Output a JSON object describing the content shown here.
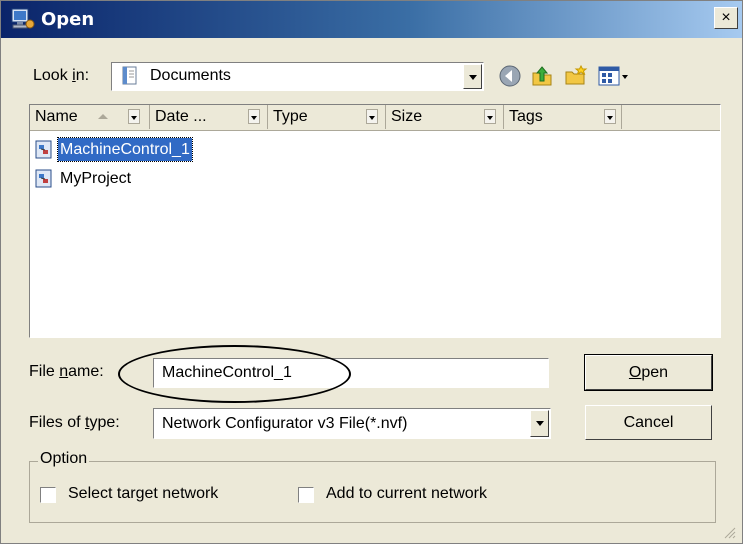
{
  "window": {
    "title": "Open",
    "close_glyph": "×"
  },
  "look_in": {
    "label_pre": "Look ",
    "label_key": "i",
    "label_post": "n:",
    "value": "Documents"
  },
  "columns": [
    {
      "label": "Name"
    },
    {
      "label": "Date ..."
    },
    {
      "label": "Type"
    },
    {
      "label": "Size"
    },
    {
      "label": "Tags"
    }
  ],
  "files": [
    {
      "name": "MachineControl_1",
      "selected": true
    },
    {
      "name": "MyProject",
      "selected": false
    }
  ],
  "file_name": {
    "label_pre": "File ",
    "label_key": "n",
    "label_post": "ame:",
    "value": "MachineControl_1"
  },
  "file_type": {
    "label_pre": "Files of ",
    "label_key": "t",
    "label_post": "ype:",
    "value": "Network Configurator v3 File(*.nvf)"
  },
  "buttons": {
    "open_key": "O",
    "open_rest": "pen",
    "cancel": "Cancel"
  },
  "option": {
    "legend": "Option",
    "select_target": "Select target network",
    "add_current": "Add to current network"
  },
  "icons": {
    "app": "network-configurator-icon",
    "folder": "folder-icon",
    "back": "back-icon",
    "up": "up-folder-icon",
    "new_folder": "new-folder-icon",
    "views": "views-menu-icon"
  },
  "colors": {
    "title_start": "#0a246a",
    "title_end": "#a6caf0",
    "selection": "#316ac5"
  }
}
